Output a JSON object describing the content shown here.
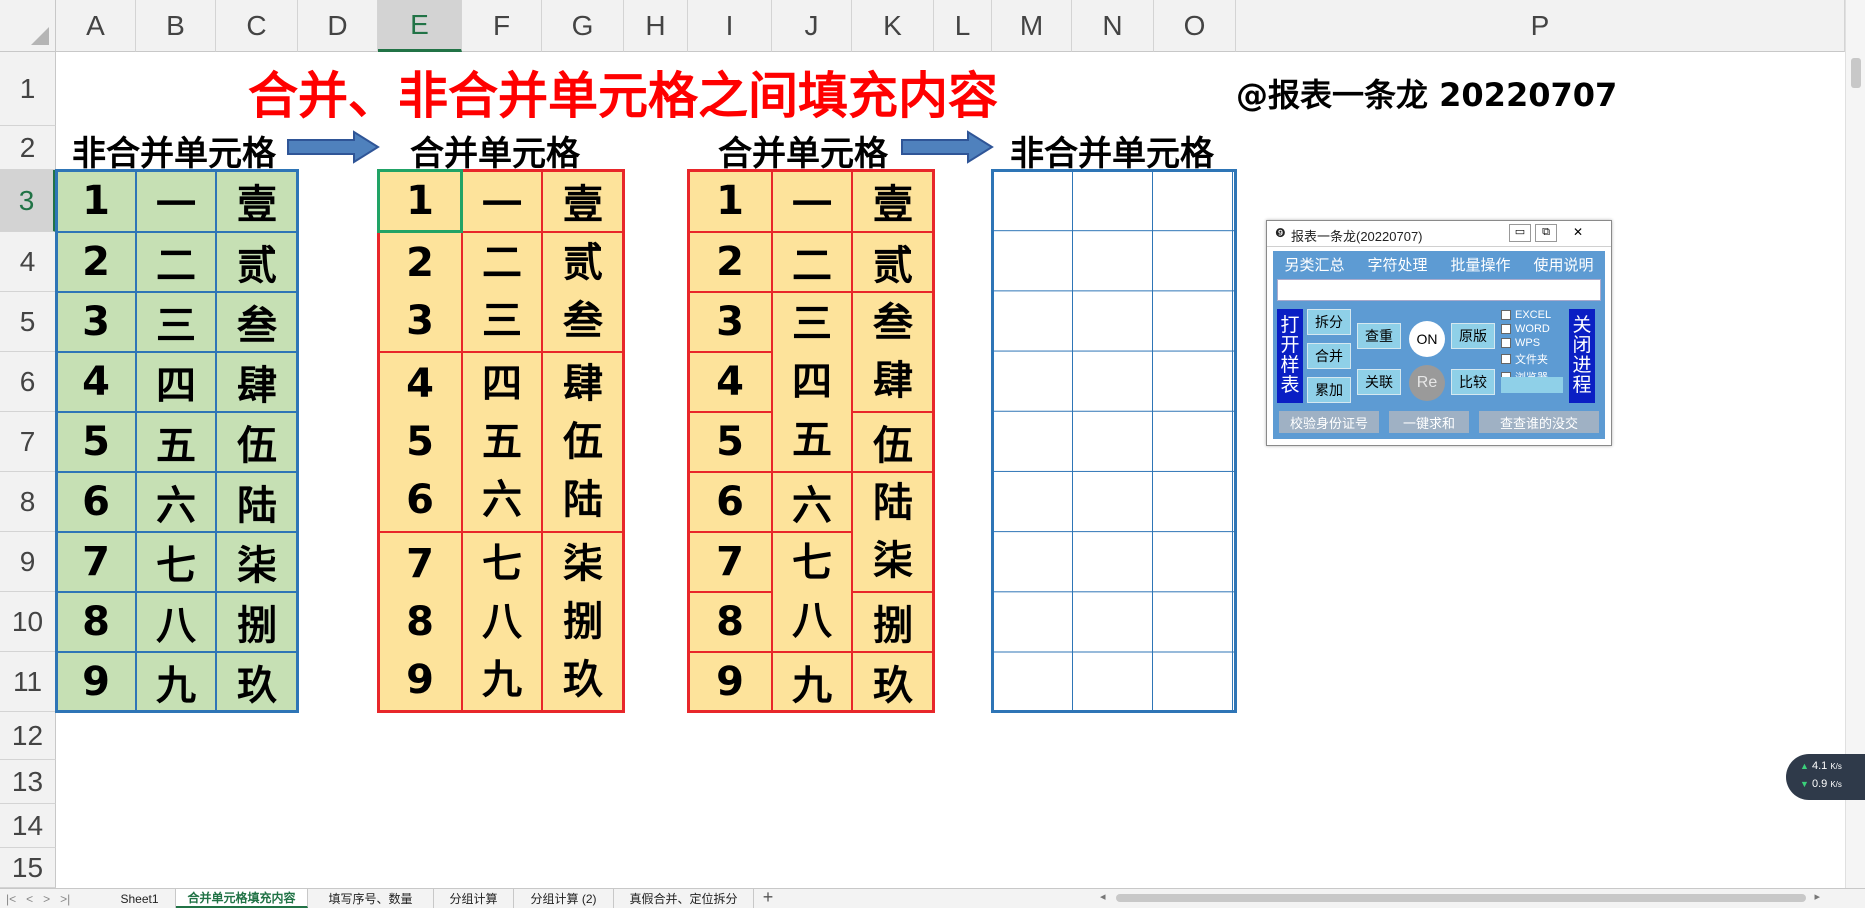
{
  "columns": [
    "A",
    "B",
    "C",
    "D",
    "E",
    "F",
    "G",
    "H",
    "I",
    "J",
    "K",
    "L",
    "M",
    "N",
    "O",
    "P"
  ],
  "rows": [
    "1",
    "2",
    "3",
    "4",
    "5",
    "6",
    "7",
    "8",
    "9",
    "10",
    "11",
    "12",
    "13",
    "14",
    "15"
  ],
  "title": "合并、非合并单元格之间填充内容",
  "author_tag": "@报表一条龙 20220707",
  "section_labels": {
    "s1": "非合并单元格",
    "s2": "合并单元格",
    "s3": "合并单元格",
    "s4": "非合并单元格"
  },
  "table1": {
    "col_a": [
      "1",
      "2",
      "3",
      "4",
      "5",
      "6",
      "7",
      "8",
      "9"
    ],
    "col_b": [
      "一",
      "二",
      "三",
      "四",
      "五",
      "六",
      "七",
      "八",
      "九"
    ],
    "col_c": [
      "壹",
      "贰",
      "叁",
      "肆",
      "伍",
      "陆",
      "柒",
      "捌",
      "玖"
    ]
  },
  "table2": {
    "row3": [
      "1",
      "一",
      "壹"
    ],
    "g1": [
      "2\n3",
      "二\n三",
      "贰\n叁"
    ],
    "g2": [
      "4\n5\n6",
      "四\n五\n六",
      "肆\n伍\n陆"
    ],
    "g3": [
      "7\n8\n9",
      "七\n八\n九",
      "柒\n捌\n玖"
    ]
  },
  "table3": {
    "col_i": [
      "1",
      "2",
      "3",
      "4",
      "5",
      "6",
      "7",
      "8",
      "9"
    ],
    "col_j": [
      "一",
      "二",
      "三\n四\n五",
      "六",
      "七\n八",
      "九"
    ],
    "col_k": [
      "壹",
      "贰",
      "叁\n肆",
      "伍",
      "陆\n柒",
      "捌",
      "玖"
    ]
  },
  "dialog": {
    "title": "报表一条龙(20220707)",
    "menu": [
      "另类汇总",
      "字符处理",
      "批量操作",
      "使用说明"
    ],
    "left_side": "打\n开\n样\n表",
    "right_side": "关\n闭\n进\n程",
    "btn_split": "拆分",
    "btn_merge": "合并",
    "btn_accum": "累加",
    "btn_dedupe": "查重",
    "btn_link": "关联",
    "btn_on": "ON",
    "btn_re": "Re",
    "btn_original": "原版",
    "btn_compare": "比较",
    "checks": [
      "EXCEL",
      "WORD",
      "WPS",
      "文件夹",
      "浏览器"
    ],
    "bottom": [
      "校验身份证号",
      "一键求和",
      "查查谁的没交"
    ]
  },
  "sheet_tabs": [
    "Sheet1",
    "合并单元格填充内容",
    "填写序号、数量",
    "分组计算",
    "分组计算 (2)",
    "真假合并、定位拆分"
  ],
  "active_tab": "合并单元格填充内容",
  "net_speed": {
    "up": "4.1",
    "down": "0.9",
    "unit": "K/s"
  },
  "colors": {
    "green_fill": "#c6e0b4",
    "orange_fill": "#fde39b",
    "blue_border": "#2e75b6",
    "red_border": "#e8272a",
    "title_red": "#ff0000",
    "excel_green": "#217346"
  }
}
